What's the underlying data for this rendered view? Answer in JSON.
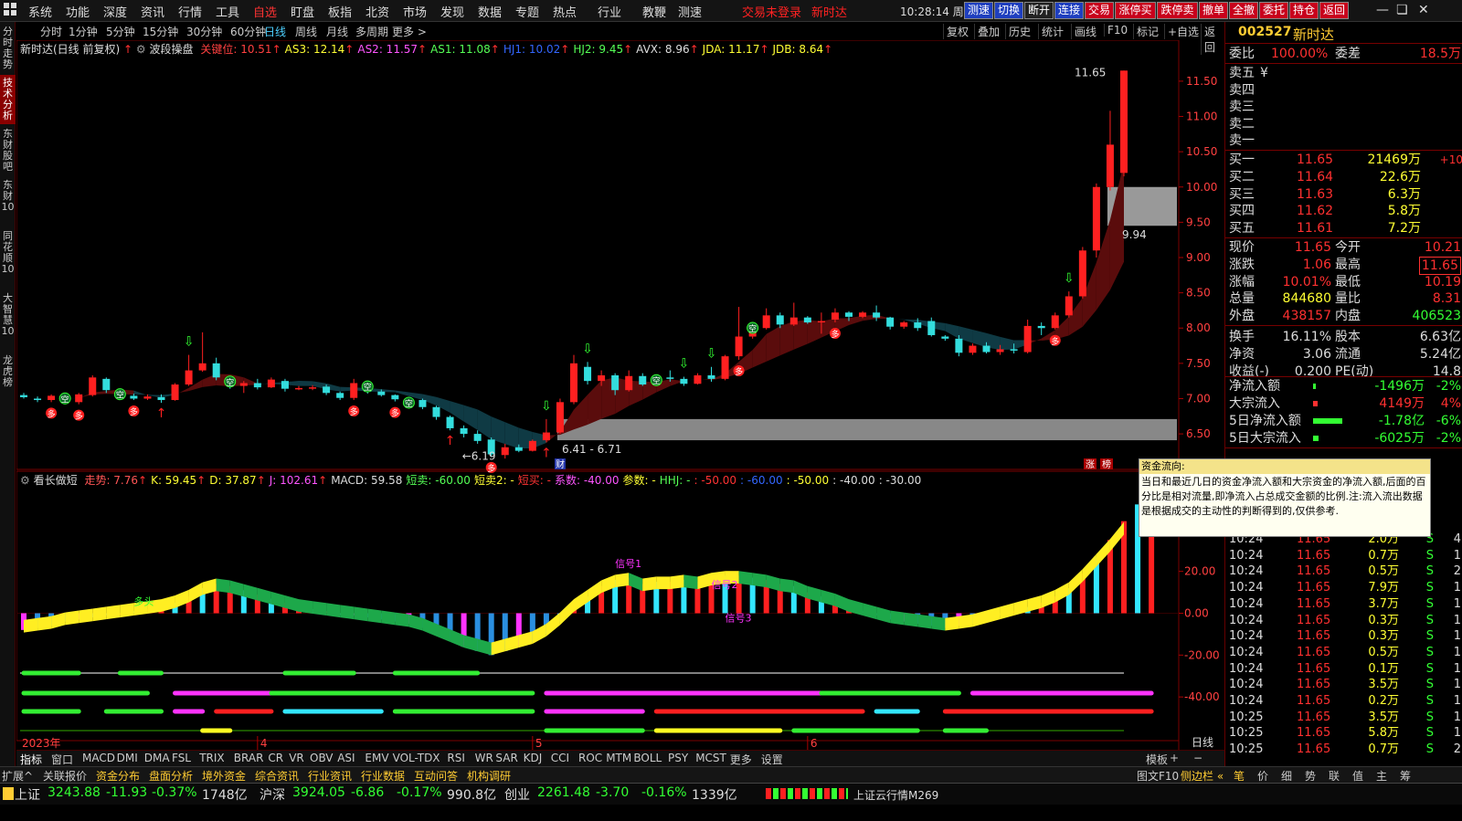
{
  "menubar": {
    "items": [
      "系统",
      "功能",
      "深度",
      "资讯",
      "行情",
      "工具",
      "自选",
      "盯盘",
      "板指",
      "北资",
      "市场",
      "发现",
      "数据",
      "专题",
      "热点",
      "行业",
      "教鞭",
      "测速"
    ],
    "active_index": 6,
    "status_trade": "交易未登录",
    "status_news": "新时达",
    "clock": "10:28:14 周二",
    "quick_buttons": [
      "测速",
      "切换",
      "断开",
      "连接",
      "交易",
      "涨停买",
      "跌停卖",
      "撤单",
      "全撤",
      "委托",
      "持仓",
      "返回"
    ]
  },
  "left_tabs": [
    "分时走势",
    "技术分析",
    "东财股吧",
    "东财10",
    "同花顺10",
    "大智慧10",
    "龙虎榜"
  ],
  "left_tabs_active": 1,
  "period_tabs": [
    "分时",
    "1分钟",
    "5分钟",
    "15分钟",
    "30分钟",
    "60分钟",
    "日线",
    "周线",
    "月线",
    "多周期",
    "更多 >"
  ],
  "period_active": 6,
  "right_tools": [
    "复权",
    "叠加",
    "历史",
    "统计",
    "画线",
    "F10",
    "标记",
    "+自选",
    "返回"
  ],
  "main_indicator": {
    "name": "新时达(日线 前复权)",
    "sub": "波段操盘",
    "items": [
      {
        "t": "关键位: 10.51",
        "c": "#ff4040"
      },
      {
        "t": "AS3: 12.14",
        "c": "#ffff33"
      },
      {
        "t": "AS2: 11.57",
        "c": "#ff55ff"
      },
      {
        "t": "AS1: 11.08",
        "c": "#55ff55"
      },
      {
        "t": "HJ1: 10.02",
        "c": "#3366ff"
      },
      {
        "t": "HJ2: 9.45",
        "c": "#55ff55"
      },
      {
        "t": "AVX: 8.96",
        "c": "#dddddd"
      },
      {
        "t": "JDA: 11.17",
        "c": "#ffff33"
      },
      {
        "t": "JDB: 8.64",
        "c": "#ffff33"
      }
    ]
  },
  "sub_indicator": {
    "name": "看长做短",
    "items": [
      {
        "t": "走势: 7.76",
        "c": "#ff5555"
      },
      {
        "t": "K: 59.45",
        "c": "#ffff33"
      },
      {
        "t": "D: 37.87",
        "c": "#ffff33"
      },
      {
        "t": "J: 102.61",
        "c": "#ff55ff"
      },
      {
        "t": "MACD: 59.58",
        "c": "#dddddd"
      },
      {
        "t": "短卖: -60.00",
        "c": "#55ff55"
      },
      {
        "t": "短卖2: -",
        "c": "#ffff33"
      },
      {
        "t": "短买: -",
        "c": "#ff3333"
      },
      {
        "t": "系数: -40.00",
        "c": "#ff55ff"
      },
      {
        "t": "参数: -",
        "c": "#ffff33"
      },
      {
        "t": "HHJ: -",
        "c": "#55ff55"
      },
      {
        "t": ": -50.00",
        "c": "#ff3333"
      },
      {
        "t": ": -60.00",
        "c": "#3366ff"
      },
      {
        "t": ": -50.00",
        "c": "#ffff33"
      },
      {
        "t": ": -40.00",
        "c": "#dddddd"
      },
      {
        "t": ": -30.00",
        "c": "#dddddd"
      }
    ]
  },
  "chart_data": {
    "type": "candlestick",
    "price_axis": {
      "ticks": [
        11.5,
        11.0,
        10.5,
        10.0,
        9.5,
        9.0,
        8.5,
        8.0,
        7.5,
        7.0,
        6.5
      ],
      "range": [
        6.1,
        11.9
      ]
    },
    "sub_axis": {
      "ticks": [
        40.0,
        20.0,
        0.0,
        -20.0,
        -40.0
      ],
      "range": [
        -60,
        60
      ]
    },
    "candles": [
      [
        7.05,
        7.08,
        7.0,
        7.02
      ],
      [
        7.0,
        7.03,
        6.95,
        6.98
      ],
      [
        6.98,
        7.06,
        6.95,
        7.04
      ],
      [
        7.04,
        7.08,
        6.93,
        6.95
      ],
      [
        6.95,
        7.08,
        6.92,
        7.06
      ],
      [
        7.05,
        7.33,
        7.03,
        7.3
      ],
      [
        7.28,
        7.3,
        7.08,
        7.12
      ],
      [
        7.12,
        7.14,
        7.02,
        7.04
      ],
      [
        7.04,
        7.07,
        6.98,
        7.0
      ],
      [
        7.0,
        7.06,
        6.98,
        7.03
      ],
      [
        7.02,
        7.06,
        6.94,
        6.98
      ],
      [
        6.98,
        7.22,
        6.97,
        7.2
      ],
      [
        7.2,
        7.62,
        7.18,
        7.4
      ],
      [
        7.4,
        7.94,
        7.38,
        7.5
      ],
      [
        7.5,
        7.58,
        7.26,
        7.3
      ],
      [
        7.3,
        7.32,
        7.14,
        7.18
      ],
      [
        7.18,
        7.25,
        7.08,
        7.22
      ],
      [
        7.22,
        7.28,
        7.13,
        7.16
      ],
      [
        7.16,
        7.3,
        7.15,
        7.27
      ],
      [
        7.25,
        7.28,
        7.1,
        7.14
      ],
      [
        7.14,
        7.18,
        7.12,
        7.15
      ],
      [
        7.15,
        7.19,
        7.12,
        7.16
      ],
      [
        7.17,
        7.2,
        7.05,
        7.08
      ],
      [
        7.08,
        7.1,
        6.98,
        7.01
      ],
      [
        7.01,
        7.28,
        6.98,
        7.22
      ],
      [
        7.22,
        7.25,
        7.07,
        7.1
      ],
      [
        7.1,
        7.13,
        7.03,
        7.05
      ],
      [
        7.05,
        7.06,
        6.96,
        6.99
      ],
      [
        6.99,
        7.02,
        6.94,
        7.0
      ],
      [
        6.98,
        7.0,
        6.85,
        6.88
      ],
      [
        6.88,
        6.9,
        6.7,
        6.74
      ],
      [
        6.74,
        6.76,
        6.55,
        6.58
      ],
      [
        6.58,
        6.62,
        6.45,
        6.5
      ],
      [
        6.5,
        6.55,
        6.36,
        6.4
      ],
      [
        6.42,
        6.45,
        6.18,
        6.21
      ],
      [
        6.2,
        6.36,
        6.15,
        6.31
      ],
      [
        6.31,
        6.35,
        6.24,
        6.26
      ],
      [
        6.26,
        6.42,
        6.25,
        6.4
      ],
      [
        6.41,
        6.71,
        6.38,
        6.52
      ],
      [
        6.52,
        7.0,
        6.5,
        6.95
      ],
      [
        6.95,
        7.62,
        6.92,
        7.5
      ],
      [
        7.45,
        7.52,
        7.2,
        7.25
      ],
      [
        7.25,
        7.4,
        7.18,
        7.33
      ],
      [
        7.33,
        7.36,
        7.05,
        7.12
      ],
      [
        7.12,
        7.4,
        7.1,
        7.32
      ],
      [
        7.32,
        7.36,
        7.18,
        7.2
      ],
      [
        7.2,
        7.34,
        7.18,
        7.3
      ],
      [
        7.3,
        7.4,
        7.24,
        7.28
      ],
      [
        7.28,
        7.31,
        7.18,
        7.21
      ],
      [
        7.21,
        7.36,
        7.2,
        7.33
      ],
      [
        7.33,
        7.45,
        7.24,
        7.28
      ],
      [
        7.28,
        7.62,
        7.26,
        7.6
      ],
      [
        7.6,
        8.3,
        7.55,
        7.88
      ],
      [
        7.88,
        8.08,
        7.85,
        8.0
      ],
      [
        8.0,
        8.28,
        7.98,
        8.18
      ],
      [
        8.18,
        8.22,
        8.0,
        8.05
      ],
      [
        8.05,
        8.36,
        8.03,
        8.15
      ],
      [
        8.15,
        8.17,
        8.06,
        8.08
      ],
      [
        8.08,
        8.22,
        7.92,
        8.1
      ],
      [
        8.12,
        8.28,
        8.08,
        8.22
      ],
      [
        8.22,
        8.24,
        8.1,
        8.16
      ],
      [
        8.16,
        8.24,
        8.14,
        8.22
      ],
      [
        8.22,
        8.32,
        8.1,
        8.15
      ],
      [
        8.15,
        8.16,
        7.98,
        8.02
      ],
      [
        8.02,
        8.1,
        7.99,
        8.08
      ],
      [
        8.08,
        8.14,
        7.96,
        8.0
      ],
      [
        8.1,
        8.15,
        7.88,
        7.9
      ],
      [
        7.88,
        7.9,
        7.82,
        7.85
      ],
      [
        7.85,
        7.9,
        7.6,
        7.65
      ],
      [
        7.65,
        7.78,
        7.62,
        7.75
      ],
      [
        7.75,
        7.8,
        7.64,
        7.66
      ],
      [
        7.66,
        7.76,
        7.62,
        7.7
      ],
      [
        7.7,
        7.78,
        7.64,
        7.68
      ],
      [
        7.66,
        8.12,
        7.64,
        8.03
      ],
      [
        8.03,
        8.08,
        7.9,
        8.0
      ],
      [
        8.0,
        8.22,
        7.98,
        8.18
      ],
      [
        8.18,
        8.52,
        8.15,
        8.45
      ],
      [
        8.45,
        9.15,
        8.42,
        9.1
      ],
      [
        9.1,
        10.05,
        9.0,
        10.0
      ],
      [
        10.0,
        11.08,
        9.95,
        10.6
      ],
      [
        10.2,
        11.65,
        10.15,
        11.65
      ]
    ],
    "macd": [
      -8,
      -7,
      -6,
      -4,
      -3,
      -2,
      -1,
      0,
      1,
      2,
      3,
      5,
      8,
      12,
      14,
      13,
      11,
      9,
      7,
      5,
      3,
      2,
      1,
      0,
      -1,
      -2,
      -3,
      -4,
      -5,
      -7,
      -10,
      -13,
      -16,
      -18,
      -20,
      -18,
      -16,
      -14,
      -10,
      -4,
      3,
      8,
      13,
      16,
      17,
      14,
      15,
      15,
      16,
      15,
      17,
      18,
      18,
      17,
      16,
      14,
      13,
      10,
      8,
      6,
      3,
      1,
      -1,
      -3,
      -4,
      -5,
      -6,
      -7,
      -6,
      -5,
      -3,
      -1,
      1,
      3,
      5,
      8,
      12,
      19,
      27,
      35,
      44,
      52,
      59.58
    ],
    "sub_labels": [
      "多头",
      "信号1",
      "信号2",
      "信号3"
    ],
    "x_labels": [
      "2023年",
      "4",
      "5",
      "6"
    ],
    "price_notes": [
      "11.65",
      "6.41 - 6.71",
      "6.19",
      "9.94"
    ]
  },
  "stock": {
    "code": "002527",
    "name": "新时达",
    "ratio_label": "委比",
    "ratio": "100.00%",
    "diff_label": "委差",
    "diff": "18.5万",
    "asks": [
      {
        "l": "卖五",
        "p": "¥",
        "v": ""
      },
      {
        "l": "卖四",
        "p": "",
        "v": ""
      },
      {
        "l": "卖三",
        "p": "",
        "v": ""
      },
      {
        "l": "卖二",
        "p": "",
        "v": ""
      },
      {
        "l": "卖一",
        "p": "",
        "v": ""
      }
    ],
    "bids": [
      {
        "l": "买一",
        "p": "11.65",
        "v": "21469万",
        "d": "+10"
      },
      {
        "l": "买二",
        "p": "11.64",
        "v": "22.6万",
        "d": ""
      },
      {
        "l": "买三",
        "p": "11.63",
        "v": "6.3万",
        "d": ""
      },
      {
        "l": "买四",
        "p": "11.62",
        "v": "5.8万",
        "d": ""
      },
      {
        "l": "买五",
        "p": "11.61",
        "v": "7.2万",
        "d": ""
      }
    ],
    "quote": [
      {
        "l": "现价",
        "v": "11.65",
        "c": "#ff3030",
        "l2": "今开",
        "v2": "10.21",
        "c2": "#ff3030"
      },
      {
        "l": "涨跌",
        "v": "1.06",
        "c": "#ff3030",
        "l2": "最高",
        "v2": "11.65",
        "c2": "#ff3030"
      },
      {
        "l": "涨幅",
        "v": "10.01%",
        "c": "#ff3030",
        "l2": "最低",
        "v2": "10.19",
        "c2": "#ff3030"
      },
      {
        "l": "总量",
        "v": "844680",
        "c": "#ffff33",
        "l2": "量比",
        "v2": "8.31",
        "c2": "#ff3030"
      },
      {
        "l": "外盘",
        "v": "438157",
        "c": "#ff3030",
        "l2": "内盘",
        "v2": "406523",
        "c2": "#33ff33"
      },
      {
        "l": "换手",
        "v": "16.11%",
        "c": "#dddddd",
        "l2": "股本",
        "v2": "6.63亿",
        "c2": "#dddddd"
      },
      {
        "l": "净资",
        "v": "3.06",
        "c": "#dddddd",
        "l2": "流通",
        "v2": "5.24亿",
        "c2": "#dddddd"
      },
      {
        "l": "收益(-)",
        "v": "0.200",
        "c": "#dddddd",
        "l2": "PE(动)",
        "v2": "14.8",
        "c2": "#dddddd"
      }
    ],
    "flows": [
      {
        "l": "净流入额",
        "v": "-1496万",
        "p": "-2%",
        "c": "#33ff33",
        "bar": 0.05
      },
      {
        "l": "大宗流入",
        "v": "4149万",
        "p": "4%",
        "c": "#ff3030",
        "bar": 0.12
      },
      {
        "l": "5日净流入额",
        "v": "-1.78亿",
        "p": "-6%",
        "c": "#33ff33",
        "bar": 0.8
      },
      {
        "l": "5日大宗流入",
        "v": "-6025万",
        "p": "-2%",
        "c": "#33ff33",
        "bar": 0.15
      }
    ],
    "ticks": [
      {
        "t": "10:24",
        "p": "11.65",
        "v": "2.0万",
        "s": "S",
        "n": "4"
      },
      {
        "t": "10:24",
        "p": "11.65",
        "v": "0.7万",
        "s": "S",
        "n": "1"
      },
      {
        "t": "10:24",
        "p": "11.65",
        "v": "0.5万",
        "s": "S",
        "n": "2"
      },
      {
        "t": "10:24",
        "p": "11.65",
        "v": "7.9万",
        "s": "S",
        "n": "1"
      },
      {
        "t": "10:24",
        "p": "11.65",
        "v": "3.7万",
        "s": "S",
        "n": "1"
      },
      {
        "t": "10:24",
        "p": "11.65",
        "v": "0.3万",
        "s": "S",
        "n": "1"
      },
      {
        "t": "10:24",
        "p": "11.65",
        "v": "0.3万",
        "s": "S",
        "n": "1"
      },
      {
        "t": "10:24",
        "p": "11.65",
        "v": "0.5万",
        "s": "S",
        "n": "1"
      },
      {
        "t": "10:24",
        "p": "11.65",
        "v": "0.1万",
        "s": "S",
        "n": "1"
      },
      {
        "t": "10:24",
        "p": "11.65",
        "v": "3.5万",
        "s": "S",
        "n": "1"
      },
      {
        "t": "10:24",
        "p": "11.65",
        "v": "0.2万",
        "s": "S",
        "n": "1"
      },
      {
        "t": "10:25",
        "p": "11.65",
        "v": "3.5万",
        "s": "S",
        "n": "1"
      },
      {
        "t": "10:25",
        "p": "11.65",
        "v": "5.8万",
        "s": "S",
        "n": "1"
      },
      {
        "t": "10:25",
        "p": "11.65",
        "v": "0.7万",
        "s": "S",
        "n": "2"
      }
    ]
  },
  "tooltip": {
    "title": "资金流向:",
    "body": "当日和最近几日的资金净流入额和大宗资金的净流入额,后面的百分比是相对流量,即净流入占总成交金额的比例.注:流入流出数据是根据成交的主动性的判断得到的,仅供参考."
  },
  "bottom_tabs": [
    "指标",
    "窗口",
    "MACD",
    "DMI",
    "DMA",
    "FSL",
    "TRIX",
    "BRAR",
    "CR",
    "VR",
    "OBV",
    "ASI",
    "EMV",
    "VOL-TDX",
    "RSI",
    "WR",
    "SAR",
    "KDJ",
    "CCI",
    "ROC",
    "MTM",
    "BOLL",
    "PSY",
    "MCST",
    "更多",
    "设置"
  ],
  "bottom_right": [
    "模板",
    "+",
    "−"
  ],
  "period_label": "日线",
  "ext_tabs": [
    "扩展^",
    "关联报价",
    "资金分布",
    "盘面分析",
    "境外资金",
    "综合资讯",
    "行业资讯",
    "行业数据",
    "互动问答",
    "机构调研"
  ],
  "ext_right": [
    "图文F10",
    "侧边栏 «"
  ],
  "ext_right_tabs": [
    "笔",
    "价",
    "细",
    "势",
    "联",
    "值",
    "主",
    "筹"
  ],
  "indices": [
    {
      "name": "上证",
      "v": "3243.88",
      "d": "-11.93",
      "p": "-0.37%",
      "a": "1748亿"
    },
    {
      "name": "沪深",
      "v": "3924.05",
      "d": "-6.86",
      "p": "-0.17%",
      "a": "990.8亿"
    },
    {
      "name": "创业",
      "v": "2261.48",
      "d": "-3.70",
      "p": "-0.16%",
      "a": "1339亿"
    }
  ],
  "feed_label": "上证云行情M269",
  "badges": [
    "涨",
    "榜"
  ],
  "fin_badge": "财"
}
